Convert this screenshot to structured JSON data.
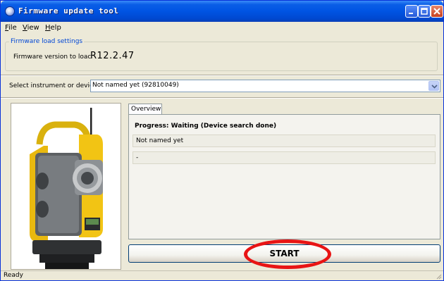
{
  "window": {
    "title": "Firmware update tool"
  },
  "menu": {
    "items": [
      "File",
      "View",
      "Help"
    ]
  },
  "firmware_group": {
    "legend": "Firmware load settings",
    "label": "Firmware version to loac",
    "version": "R12.2.47"
  },
  "device": {
    "label": "Select instrument or device",
    "selected": "Not named yet (92810049)"
  },
  "tabs": {
    "overview": "Overview"
  },
  "overview": {
    "progress": "Progress: Waiting (Device search done)",
    "device_name": "Not named yet",
    "status_value": "-"
  },
  "actions": {
    "start_label": "START"
  },
  "status": {
    "text": "Ready"
  },
  "colors": {
    "highlight": "#e81414",
    "titlebar": "#0054e3",
    "instrument_body": "#f2c414"
  }
}
